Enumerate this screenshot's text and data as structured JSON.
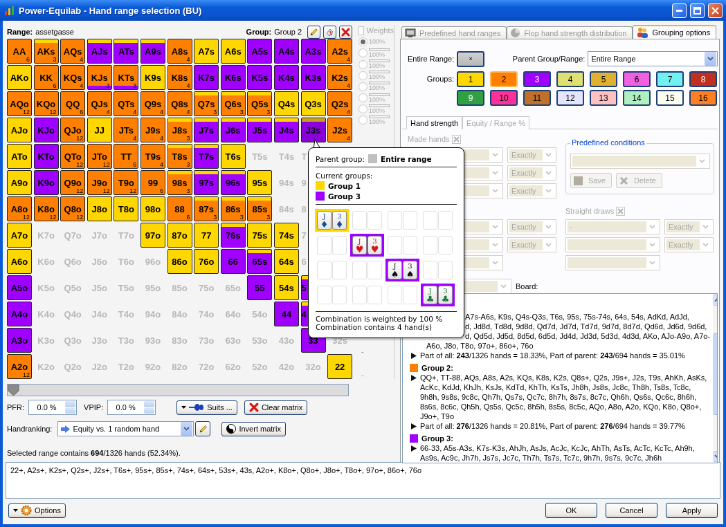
{
  "window": {
    "title": "Power-Equilab - Hand range selection (BU)"
  },
  "range": {
    "label": "Range:",
    "name": "assetgasse"
  },
  "group": {
    "label": "Group:",
    "name": "Group 2"
  },
  "weights": {
    "label": "Weights",
    "checked": false,
    "disabled": true,
    "options": [
      {
        "selected": true,
        "kind": "plain",
        "reading": "100%"
      },
      {
        "selected": false,
        "kind": "bar",
        "reading": "100%"
      },
      {
        "selected": false,
        "kind": "bar",
        "reading": "100%"
      },
      {
        "selected": false,
        "kind": "bar",
        "reading": "100%"
      },
      {
        "selected": false,
        "kind": "bar",
        "reading": "100%"
      },
      {
        "selected": false,
        "kind": "bar",
        "reading": "100%"
      },
      {
        "selected": false,
        "kind": "bar",
        "reading": "100%"
      },
      {
        "selected": false,
        "kind": "bar",
        "reading": "100%"
      }
    ],
    "dashes": [
      "-",
      "-"
    ]
  },
  "matrix": {
    "rows": [
      [
        {
          "label": "AA",
          "color": "#ff8000",
          "count": "6"
        },
        {
          "label": "AKs",
          "color": "#ff8000",
          "band": {
            "kind": "top",
            "color": "#ffd700"
          },
          "count": "3"
        },
        {
          "label": "AQs",
          "color": "#ff8000",
          "count": "4"
        },
        {
          "label": "AJs",
          "color": "#a000ff",
          "band": {
            "kind": "top",
            "color": "#ffd700"
          }
        },
        {
          "label": "ATs",
          "color": "#a000ff",
          "band": {
            "kind": "top",
            "color": "#ffd700"
          }
        },
        {
          "label": "A9s",
          "color": "#a000ff",
          "band": {
            "kind": "top",
            "color": "#ffd700"
          }
        },
        {
          "label": "A8s",
          "color": "#ff8000",
          "count": "4"
        },
        {
          "label": "A7s",
          "color": "#ffd700"
        },
        {
          "label": "A6s",
          "color": "#ffd700"
        },
        {
          "label": "A5s",
          "color": "#a000ff"
        },
        {
          "label": "A4s",
          "color": "#a000ff"
        },
        {
          "label": "A3s",
          "color": "#a000ff"
        },
        {
          "label": "A2s",
          "color": "#ff8000",
          "count": "4"
        }
      ],
      [
        {
          "label": "AKo",
          "color": "#ffd700"
        },
        {
          "label": "KK",
          "color": "#ff8000",
          "count": "6"
        },
        {
          "label": "KQs",
          "color": "#ff8000",
          "count": "4"
        },
        {
          "label": "KJs",
          "color": "#ff8000",
          "band": {
            "kind": "bottom",
            "color": "#a000ff"
          },
          "count": "3"
        },
        {
          "label": "KTs",
          "color": "#ff8000",
          "band": {
            "kind": "bottom",
            "color": "#a000ff"
          },
          "count": "3"
        },
        {
          "label": "K9s",
          "color": "#ffd700"
        },
        {
          "label": "K8s",
          "color": "#ff8000",
          "count": "4"
        },
        {
          "label": "K7s",
          "color": "#a000ff"
        },
        {
          "label": "K6s",
          "color": "#a000ff"
        },
        {
          "label": "K5s",
          "color": "#a000ff"
        },
        {
          "label": "K4s",
          "color": "#a000ff"
        },
        {
          "label": "K3s",
          "color": "#a000ff"
        },
        {
          "label": "K2s",
          "color": "#ff8000",
          "count": "4"
        }
      ],
      [
        {
          "label": "AQo",
          "color": "#ff8000",
          "count": "12"
        },
        {
          "label": "KQo",
          "color": "#ff8000",
          "count": "12"
        },
        {
          "label": "QQ",
          "color": "#ff8000",
          "count": "6"
        },
        {
          "label": "QJs",
          "color": "#ff8000",
          "count": "4"
        },
        {
          "label": "QTs",
          "color": "#ff8000",
          "count": "4"
        },
        {
          "label": "Q9s",
          "color": "#ff8000",
          "count": "4"
        },
        {
          "label": "Q8s",
          "color": "#ff8000",
          "count": "4"
        },
        {
          "label": "Q7s",
          "color": "#ff8000",
          "band": {
            "kind": "top",
            "color": "#ffd700"
          },
          "count": "3"
        },
        {
          "label": "Q6s",
          "color": "#ff8000",
          "band": {
            "kind": "top",
            "color": "#ffd700"
          },
          "count": "3"
        },
        {
          "label": "Q5s",
          "color": "#ff8000",
          "band": {
            "kind": "top",
            "color": "#ffd700"
          },
          "count": "3"
        },
        {
          "label": "Q4s",
          "color": "#ffd700"
        },
        {
          "label": "Q3s",
          "color": "#ffd700"
        },
        {
          "label": "Q2s",
          "color": "#ff8000",
          "count": "4"
        }
      ],
      [
        {
          "label": "AJo",
          "color": "#ffd700"
        },
        {
          "label": "KJo",
          "color": "#a000ff"
        },
        {
          "label": "QJo",
          "color": "#ff8000",
          "count": "12"
        },
        {
          "label": "JJ",
          "color": "#ffd700"
        },
        {
          "label": "JTs",
          "color": "#ff8000",
          "count": "4"
        },
        {
          "label": "J9s",
          "color": "#ff8000",
          "count": "4"
        },
        {
          "label": "J8s",
          "color": "#ff8000",
          "band": {
            "kind": "top",
            "color": "#ffd700"
          },
          "count": "3"
        },
        {
          "label": "J7s",
          "color": "#a000ff",
          "band": {
            "kind": "top",
            "color": "#ffd700"
          }
        },
        {
          "label": "J6s",
          "color": "#a000ff",
          "band": {
            "kind": "top",
            "color": "#ffd700"
          }
        },
        {
          "label": "J5s",
          "color": "#a000ff",
          "band": {
            "kind": "top",
            "color": "#ffd700"
          }
        },
        {
          "label": "J4s",
          "color": "#a000ff",
          "band": {
            "kind": "top",
            "color": "#ffd700"
          }
        },
        {
          "label": "J3s",
          "color": "#8a00d8",
          "band": {
            "kind": "top",
            "color": "#c8a020"
          }
        },
        {
          "label": "J2s",
          "color": "#ff8000",
          "count": "4"
        }
      ],
      [
        {
          "label": "ATo",
          "color": "#ffd700"
        },
        {
          "label": "KTo",
          "color": "#a000ff"
        },
        {
          "label": "QTo",
          "color": "#ff8000",
          "count": "12"
        },
        {
          "label": "JTo",
          "color": "#ff8000",
          "count": "12"
        },
        {
          "label": "TT",
          "color": "#ff8000",
          "count": "6"
        },
        {
          "label": "T9s",
          "color": "#ff8000",
          "count": "4"
        },
        {
          "label": "T8s",
          "color": "#ff8000",
          "band": {
            "kind": "top",
            "color": "#ffd700"
          },
          "count": "3"
        },
        {
          "label": "T7s",
          "color": "#a000ff",
          "band": {
            "kind": "top",
            "color": "#ffd700"
          }
        },
        {
          "label": "T6s",
          "color": "#ffd700"
        },
        {
          "label": "T5s"
        },
        {
          "label": "T4s"
        },
        {
          "label": "T",
          "kind": "partial"
        }
      ],
      [
        {
          "label": "A9o",
          "color": "#ffd700"
        },
        {
          "label": "K9o",
          "color": "#a000ff"
        },
        {
          "label": "Q9o",
          "color": "#ff8000",
          "count": "12"
        },
        {
          "label": "J9o",
          "color": "#ff8000",
          "count": "12"
        },
        {
          "label": "T9o",
          "color": "#ff8000",
          "count": "12"
        },
        {
          "label": "99",
          "color": "#ff8000",
          "count": "6"
        },
        {
          "label": "98s",
          "color": "#ff8000",
          "band": {
            "kind": "top",
            "color": "#ffd700"
          },
          "count": "3"
        },
        {
          "label": "97s",
          "color": "#a000ff",
          "band": {
            "kind": "top",
            "color": "#ffd700"
          }
        },
        {
          "label": "96s",
          "color": "#a000ff",
          "band": {
            "kind": "top",
            "color": "#ffd700"
          }
        },
        {
          "label": "95s",
          "color": "#ffd700"
        },
        {
          "label": "94s"
        },
        {
          "label": "9",
          "kind": "partial"
        }
      ],
      [
        {
          "label": "A8o",
          "color": "#ff8000",
          "count": "12"
        },
        {
          "label": "K8o",
          "color": "#ff8000",
          "count": "12"
        },
        {
          "label": "Q8o",
          "color": "#ff8000",
          "count": "12"
        },
        {
          "label": "J8o",
          "color": "#ffd700"
        },
        {
          "label": "T8o",
          "color": "#ffd700"
        },
        {
          "label": "98o",
          "color": "#ffd700"
        },
        {
          "label": "88",
          "color": "#ff8000",
          "count": "6"
        },
        {
          "label": "87s",
          "color": "#ff8000",
          "band": {
            "kind": "top",
            "color": "#ffd700"
          },
          "count": "3"
        },
        {
          "label": "86s",
          "color": "#ff8000",
          "band": {
            "kind": "top",
            "color": "#ffd700"
          },
          "count": "3"
        },
        {
          "label": "85s",
          "color": "#ff8000",
          "band": {
            "kind": "top",
            "color": "#ffd700"
          },
          "count": "3"
        },
        {
          "label": "84s"
        },
        {
          "label": "8",
          "kind": "partial"
        }
      ],
      [
        {
          "label": "A7o",
          "color": "#ffd700"
        },
        {
          "label": "K7o"
        },
        {
          "label": "Q7o"
        },
        {
          "label": "J7o"
        },
        {
          "label": "T7o"
        },
        {
          "label": "97o",
          "color": "#ffd700"
        },
        {
          "label": "87o",
          "color": "#ffd700"
        },
        {
          "label": "77",
          "color": "#ffd700"
        },
        {
          "label": "76s",
          "color": "#a000ff",
          "band": {
            "kind": "top",
            "color": "#ffd700"
          }
        },
        {
          "label": "75s",
          "color": "#ffd700"
        },
        {
          "label": "74s",
          "color": "#ffd700"
        },
        {
          "label": "7",
          "kind": "partial"
        }
      ],
      [
        {
          "label": "A6o",
          "color": "#ffd700"
        },
        {
          "label": "K6o"
        },
        {
          "label": "Q6o"
        },
        {
          "label": "J6o"
        },
        {
          "label": "T6o"
        },
        {
          "label": "96o"
        },
        {
          "label": "86o",
          "color": "#ffd700"
        },
        {
          "label": "76o",
          "color": "#ffd700"
        },
        {
          "label": "66",
          "color": "#a000ff"
        },
        {
          "label": "65s",
          "color": "#a000ff",
          "band": {
            "kind": "top",
            "color": "#ffd700"
          }
        },
        {
          "label": "64s",
          "color": "#ffd700"
        },
        {
          "label": "6",
          "kind": "partial"
        }
      ],
      [
        {
          "label": "A5o",
          "color": "#a000ff"
        },
        {
          "label": "K5o"
        },
        {
          "label": "Q5o"
        },
        {
          "label": "J5o"
        },
        {
          "label": "T5o"
        },
        {
          "label": "95o"
        },
        {
          "label": "85o"
        },
        {
          "label": "75o"
        },
        {
          "label": "65o"
        },
        {
          "label": "55",
          "color": "#a000ff"
        },
        {
          "label": "54s",
          "color": "#ffd700"
        },
        {
          "label": "5",
          "kind": "partial",
          "color": "#a000ff",
          "band": {
            "kind": "top",
            "color": "#ffd700"
          }
        }
      ],
      [
        {
          "label": "A4o",
          "color": "#a000ff"
        },
        {
          "label": "K4o"
        },
        {
          "label": "Q4o"
        },
        {
          "label": "J4o"
        },
        {
          "label": "T4o"
        },
        {
          "label": "94o"
        },
        {
          "label": "84o"
        },
        {
          "label": "74o"
        },
        {
          "label": "64o"
        },
        {
          "label": "54o"
        },
        {
          "label": "44",
          "color": "#a000ff"
        },
        {
          "label": "4",
          "kind": "partial",
          "color": "#a000ff",
          "band": {
            "kind": "top",
            "color": "#ffd700"
          }
        }
      ],
      [
        {
          "label": "A3o",
          "color": "#a000ff"
        },
        {
          "label": "K3o"
        },
        {
          "label": "Q3o"
        },
        {
          "label": "J3o"
        },
        {
          "label": "T3o"
        },
        {
          "label": "93o"
        },
        {
          "label": "83o"
        },
        {
          "label": "73o"
        },
        {
          "label": "63o"
        },
        {
          "label": "53o"
        },
        {
          "label": "43o"
        },
        {
          "label": "33",
          "color": "#a000ff"
        },
        {
          "label": "32s"
        }
      ],
      [
        {
          "label": "A2o",
          "color": "#ff8000",
          "count": "12"
        },
        {
          "label": "K2o"
        },
        {
          "label": "Q2o"
        },
        {
          "label": "J2o"
        },
        {
          "label": "T2o"
        },
        {
          "label": "92o"
        },
        {
          "label": "82o"
        },
        {
          "label": "72o"
        },
        {
          "label": "62o"
        },
        {
          "label": "52o"
        },
        {
          "label": "42o"
        },
        {
          "label": "32o"
        },
        {
          "label": "22",
          "color": "#ffd700"
        }
      ]
    ]
  },
  "slider": {
    "level": 0
  },
  "pfr": {
    "label": "PFR:",
    "value": "0.0 %"
  },
  "vpip": {
    "label": "VPIP:",
    "value": "0.0 %"
  },
  "suits_button": "Suits ...",
  "clear_button": "Clear matrix",
  "handranking": {
    "label": "Handranking:",
    "value": "Equity vs. 1 random hand"
  },
  "invert_button": "Invert matrix",
  "summary": "Selected range contains **694**/1326 hands (52.34%).",
  "tooltip": {
    "parent": {
      "label": "Parent group:",
      "name": "Entire range",
      "color": "#c0c0c0"
    },
    "current_label": "Current groups:",
    "groups": [
      {
        "name": "Group 1",
        "color": "#ffd700"
      },
      {
        "name": "Group 3",
        "color": "#a000ff"
      }
    ],
    "combo_rows": [
      [
        {
          "kind": "combo",
          "color": "#ffd700",
          "cards": [
            {
              "rank": "J",
              "suit": "♦",
              "color": "#1a4a9c"
            },
            {
              "rank": "3",
              "suit": "♦",
              "color": "#1a4a9c"
            }
          ]
        },
        {
          "kind": "empty"
        },
        {
          "kind": "empty"
        },
        {
          "kind": "empty"
        }
      ],
      [
        {
          "kind": "empty"
        },
        {
          "kind": "combo",
          "color": "#a000ff",
          "cards": [
            {
              "rank": "J",
              "suit": "♥",
              "color": "#d01818"
            },
            {
              "rank": "3",
              "suit": "♥",
              "color": "#d01818"
            }
          ]
        },
        {
          "kind": "empty"
        },
        {
          "kind": "empty"
        }
      ],
      [
        {
          "kind": "empty"
        },
        {
          "kind": "empty"
        },
        {
          "kind": "combo",
          "color": "#a000ff",
          "cards": [
            {
              "rank": "J",
              "suit": "♠",
              "color": "#111111"
            },
            {
              "rank": "3",
              "suit": "♠",
              "color": "#111111"
            }
          ]
        },
        {
          "kind": "empty"
        }
      ],
      [
        {
          "kind": "empty"
        },
        {
          "kind": "empty"
        },
        {
          "kind": "empty"
        },
        {
          "kind": "combo",
          "color": "#a000ff",
          "cards": [
            {
              "rank": "J",
              "suit": "♣",
              "color": "#187830"
            },
            {
              "rank": "3",
              "suit": "♣",
              "color": "#187830"
            }
          ]
        }
      ]
    ],
    "weight_note": "Combination is weighted by 100 %",
    "count_note": "Combination contains 4 hand(s)"
  },
  "tabs": [
    {
      "label": "Predefined hand ranges",
      "selected": false,
      "kind": "monitor"
    },
    {
      "label": "Flop hand strength distribution",
      "selected": false,
      "kind": "globe"
    },
    {
      "label": "Grouping options",
      "selected": true,
      "kind": "people"
    }
  ],
  "grouping": {
    "entire_range": {
      "label": "Entire Range:",
      "mark": "×"
    },
    "parent": {
      "label": "Parent Group/Range:",
      "value": "Entire Range"
    },
    "groups_label": "Groups:",
    "groups": [
      {
        "label": "1",
        "color": "#ffd700",
        "selected": false
      },
      {
        "label": "2",
        "color": "#ff8000",
        "selected": true
      },
      {
        "label": "3",
        "color": "#a000ff",
        "selected": false
      },
      {
        "label": "4",
        "color": "#e0e070",
        "selected": false
      },
      {
        "label": "5",
        "color": "#e0b030",
        "selected": false
      },
      {
        "label": "6",
        "color": "#f060e0",
        "selected": false
      },
      {
        "label": "7",
        "color": "#70f0f0",
        "selected": false
      },
      {
        "label": "8",
        "color": "#c03020",
        "selected": false
      },
      {
        "label": "9",
        "color": "#30a040",
        "selected": false
      },
      {
        "label": "10",
        "color": "#ff3098",
        "selected": false
      },
      {
        "label": "11",
        "color": "#c07028",
        "selected": false
      },
      {
        "label": "12",
        "color": "#e4e4fc",
        "selected": false
      },
      {
        "label": "13",
        "color": "#ffc0c0",
        "selected": false
      },
      {
        "label": "14",
        "color": "#b0f0c0",
        "selected": false
      },
      {
        "label": "15",
        "color": "#fffff0",
        "selected": false
      },
      {
        "label": "16",
        "color": "#ff8020",
        "selected": false
      }
    ]
  },
  "subtabs": [
    {
      "label": "Hand strength",
      "selected": true
    },
    {
      "label": "Equity / Range %",
      "selected": false
    }
  ],
  "conditions": {
    "disabled": true,
    "made_hands": "Made hands",
    "rows_a": [
      {
        "mode": "Exactly"
      },
      {
        "mode": "Exactly"
      },
      {
        "mode": "Exactly"
      }
    ],
    "predefined": {
      "title": "Predefined conditions",
      "save": "Save",
      "delete": "Delete"
    },
    "straight_draws": "Straight draws",
    "rows_b": [
      {
        "kind": "full",
        "mode": "Exactly",
        "draw": "-",
        "draw_mode": "Exactly"
      },
      {
        "kind": "full",
        "mode": "Exactly",
        "draw_mode": "Exactly"
      },
      {
        "kind": "blank"
      }
    ],
    "board": "Board:"
  },
  "groups_list": [
    {
      "lines": [
        "A7s-A6s, K9s, Q4s-Q3s, T6s, 95s, 75s-74s, 64s, 54s, AdKd, AdJd,",
        "d, Jd8d, Td8d, 9d8d, Qd7d, Jd7d, Td7d, 9d7d, 8d7d, Qd6d, Jd6d, 9d6d,",
        "d, Qd5d, Jd5d, 8d5d, 6d5d, Jd4d, Jd3d, 5d3d, 4d3d, AKo, AJo-A9o, A7o-"
      ],
      "text": "A6o, J8o, T8o, 97o+, 86o+, 76o",
      "summary": "Part of all: **243**/1326 hands = 18.33%, Part of parent: **243**/694 hands = 35.01%"
    },
    {
      "name": "Group 2:",
      "color": "#ff8000",
      "text": "QQ+, TT-88, AQs, A8s, A2s, KQs, K8s, K2s, Q8s+, Q2s, J9s+, J2s, T9s, AhKh, AsKs, AcKc, KdJd, KhJh, KsJs, KdTd, KhTh, KsTs, Jh8h, Js8s, Jc8c, Th8h, Ts8s, Tc8c, 9h8h, 9s8s, 9c8c, Qh7h, Qs7s, Qc7c, 8h7h, 8s7s, 8c7c, Qh6h, Qs6s, Qc6c, 8h6h, 8s6s, 8c6c, Qh5h, Qs5s, Qc5c, 8h5h, 8s5s, 8c5c, AQo, A8o, A2o, KQo, K8o, Q8o+, J9o+, T9o",
      "summary": "Part of all: **276**/1326 hands = 20.81%, Part of parent: **276**/694 hands = 39.77%"
    },
    {
      "name": "Group 3:",
      "color": "#a000ff",
      "text": "66-33, A5s-A3s, K7s-K3s, AhJh, AsJs, AcJc, KcJc, AhTh, AsTs, AcTc, KcTc, Ah9h, As9s, Ac9c, Jh7h, Js7s, Jc7c, Th7h, Ts7s, Tc7c, 9h7h, 9s7s, 9c7c, Jh6h"
    }
  ],
  "range_text": "22+, A2s+, K2s+, Q2s+, J2s+, T6s+, 95s+, 85s+, 74s+, 64s+, 53s+, 43s, A2o+, K8o+, Q8o+, J8o+, T8o+, 97o+, 86o+, 76o",
  "buttons": {
    "options": "Options",
    "ok": "OK",
    "cancel": "Cancel",
    "apply": "Apply"
  }
}
